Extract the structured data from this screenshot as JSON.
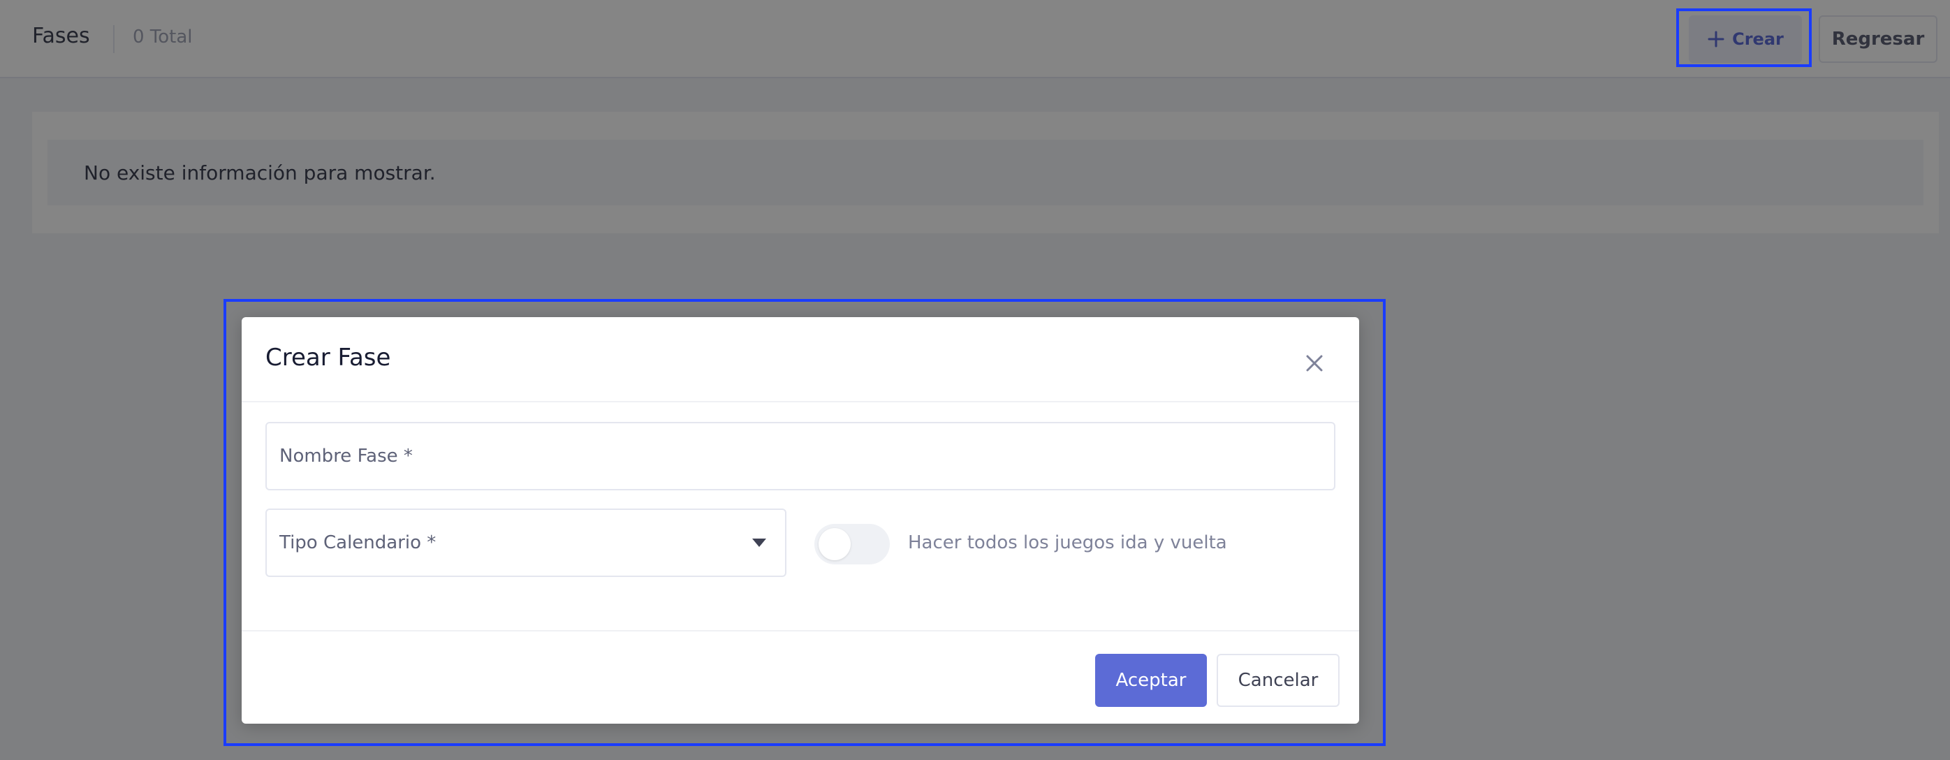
{
  "header": {
    "title": "Fases",
    "total": "0 Total",
    "create_label": "Crear",
    "back_label": "Regresar"
  },
  "content": {
    "empty_message": "No existe información para mostrar."
  },
  "modal": {
    "title": "Crear Fase",
    "nombre_placeholder": "Nombre Fase *",
    "tipo_label": "Tipo Calendario *",
    "toggle_label": "Hacer todos los juegos ida y vuelta",
    "toggle_on": false,
    "accept_label": "Aceptar",
    "cancel_label": "Cancelar"
  },
  "icons": {
    "create": "plus-icon",
    "close": "close-icon",
    "dropdown": "caret-down-icon"
  },
  "colors": {
    "primary": "#5c6bd6",
    "highlight": "#1a3cff"
  }
}
